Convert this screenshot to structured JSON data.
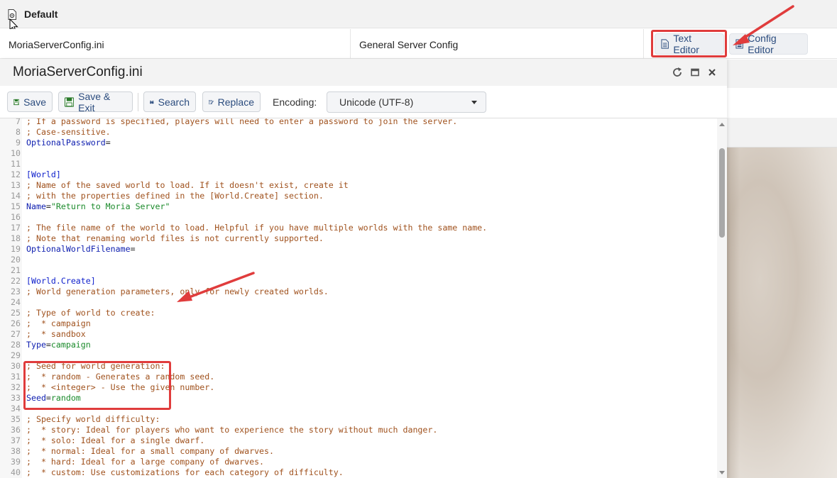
{
  "background": {
    "group_title": "Default",
    "row": {
      "filename": "MoriaServerConfig.ini",
      "description": "General Server Config",
      "text_editor_label": "Text Editor",
      "config_editor_label": "Config Editor"
    }
  },
  "dialog": {
    "title": "MoriaServerConfig.ini",
    "toolbar": {
      "save_label": "Save",
      "save_exit_label": "Save & Exit",
      "search_label": "Search",
      "replace_label": "Replace",
      "encoding_label": "Encoding:",
      "encoding_value": "Unicode (UTF-8)"
    },
    "editor": {
      "lines": [
        {
          "n": "7",
          "parts": [
            [
              "c",
              "; If a password is specified, players will need to enter a password to join the server."
            ]
          ]
        },
        {
          "n": "8",
          "parts": [
            [
              "c",
              "; Case-sensitive."
            ]
          ]
        },
        {
          "n": "9",
          "parts": [
            [
              "k",
              "OptionalPassword"
            ],
            [
              "p",
              "="
            ]
          ]
        },
        {
          "n": "10",
          "parts": []
        },
        {
          "n": "11",
          "parts": []
        },
        {
          "n": "12",
          "parts": [
            [
              "s",
              "[World]"
            ]
          ]
        },
        {
          "n": "13",
          "parts": [
            [
              "c",
              "; Name of the saved world to load. If it doesn't exist, create it"
            ]
          ]
        },
        {
          "n": "14",
          "parts": [
            [
              "c",
              "; with the properties defined in the [World.Create] section."
            ]
          ]
        },
        {
          "n": "15",
          "parts": [
            [
              "k",
              "Name"
            ],
            [
              "p",
              "="
            ],
            [
              "v",
              "\"Return to Moria Server\""
            ]
          ]
        },
        {
          "n": "16",
          "parts": []
        },
        {
          "n": "17",
          "parts": [
            [
              "c",
              "; The file name of the world to load. Helpful if you have multiple worlds with the same name."
            ]
          ]
        },
        {
          "n": "18",
          "parts": [
            [
              "c",
              "; Note that renaming world files is not currently supported."
            ]
          ]
        },
        {
          "n": "19",
          "parts": [
            [
              "k",
              "OptionalWorldFilename"
            ],
            [
              "p",
              "="
            ]
          ]
        },
        {
          "n": "20",
          "parts": []
        },
        {
          "n": "21",
          "parts": []
        },
        {
          "n": "22",
          "parts": [
            [
              "s",
              "[World.Create]"
            ]
          ]
        },
        {
          "n": "23",
          "parts": [
            [
              "c",
              "; World generation parameters, only for newly created worlds."
            ]
          ]
        },
        {
          "n": "24",
          "parts": []
        },
        {
          "n": "25",
          "parts": [
            [
              "c",
              "; Type of world to create:"
            ]
          ]
        },
        {
          "n": "26",
          "parts": [
            [
              "c",
              ";  * campaign"
            ]
          ]
        },
        {
          "n": "27",
          "parts": [
            [
              "c",
              ";  * sandbox"
            ]
          ]
        },
        {
          "n": "28",
          "parts": [
            [
              "k",
              "Type"
            ],
            [
              "p",
              "="
            ],
            [
              "v",
              "campaign"
            ]
          ]
        },
        {
          "n": "29",
          "parts": []
        },
        {
          "n": "30",
          "parts": [
            [
              "c",
              "; Seed for world generation:"
            ]
          ]
        },
        {
          "n": "31",
          "parts": [
            [
              "c",
              ";  * random - Generates a random seed."
            ]
          ]
        },
        {
          "n": "32",
          "parts": [
            [
              "c",
              ";  * <integer> - Use the given number."
            ]
          ]
        },
        {
          "n": "33",
          "parts": [
            [
              "k",
              "Seed"
            ],
            [
              "p",
              "="
            ],
            [
              "v",
              "random"
            ]
          ]
        },
        {
          "n": "34",
          "parts": []
        },
        {
          "n": "35",
          "parts": [
            [
              "c",
              "; Specify world difficulty:"
            ]
          ]
        },
        {
          "n": "36",
          "parts": [
            [
              "c",
              ";  * story: Ideal for players who want to experience the story without much danger."
            ]
          ]
        },
        {
          "n": "37",
          "parts": [
            [
              "c",
              ";  * solo: Ideal for a single dwarf."
            ]
          ]
        },
        {
          "n": "38",
          "parts": [
            [
              "c",
              ";  * normal: Ideal for a small company of dwarves."
            ]
          ]
        },
        {
          "n": "39",
          "parts": [
            [
              "c",
              ";  * hard: Ideal for a large company of dwarves."
            ]
          ]
        },
        {
          "n": "40",
          "parts": [
            [
              "c",
              ";  * custom: Use customizations for each category of difficulty."
            ]
          ]
        }
      ]
    }
  },
  "colors": {
    "accent": "#2b4c7e",
    "highlight": "#e03c3c",
    "comment": "#a0521e",
    "section": "#1122cc",
    "value": "#1a8a2a"
  }
}
